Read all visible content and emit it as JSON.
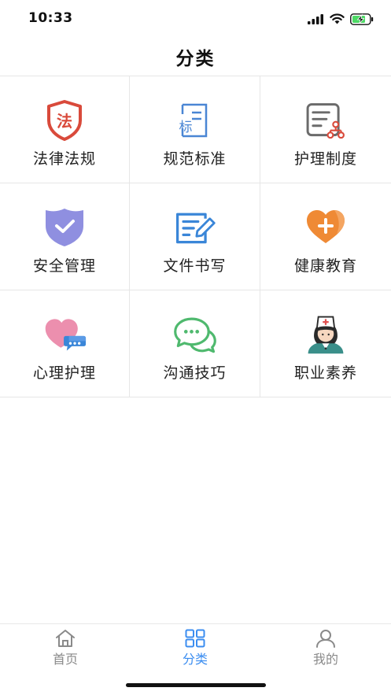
{
  "status": {
    "time": "10:33"
  },
  "nav": {
    "title": "分类"
  },
  "categories": [
    {
      "label": "法律法规",
      "icon": "law-shield-icon",
      "badge": "法",
      "color": "#d94a3b"
    },
    {
      "label": "规范标准",
      "icon": "standard-doc-icon",
      "badge": "标",
      "color": "#4a86d4"
    },
    {
      "label": "护理制度",
      "icon": "system-chart-icon",
      "color": "#6b6b6b"
    },
    {
      "label": "安全管理",
      "icon": "safety-shield-icon",
      "color": "#8f8fe0"
    },
    {
      "label": "文件书写",
      "icon": "document-write-icon",
      "color": "#3a86d8"
    },
    {
      "label": "健康教育",
      "icon": "health-heart-icon",
      "color": "#ef8a35"
    },
    {
      "label": "心理护理",
      "icon": "heart-chat-icon",
      "color": "#ec8fae"
    },
    {
      "label": "沟通技巧",
      "icon": "chat-bubbles-icon",
      "color": "#4fb96e"
    },
    {
      "label": "职业素养",
      "icon": "nurse-icon",
      "color": "#3a8f8a"
    }
  ],
  "tabs": [
    {
      "label": "首页",
      "icon": "home-icon",
      "active": false
    },
    {
      "label": "分类",
      "icon": "grid-icon",
      "active": true
    },
    {
      "label": "我的",
      "icon": "user-icon",
      "active": false
    }
  ],
  "colors": {
    "accent": "#3b8df0",
    "inactive": "#8a8a8a"
  }
}
